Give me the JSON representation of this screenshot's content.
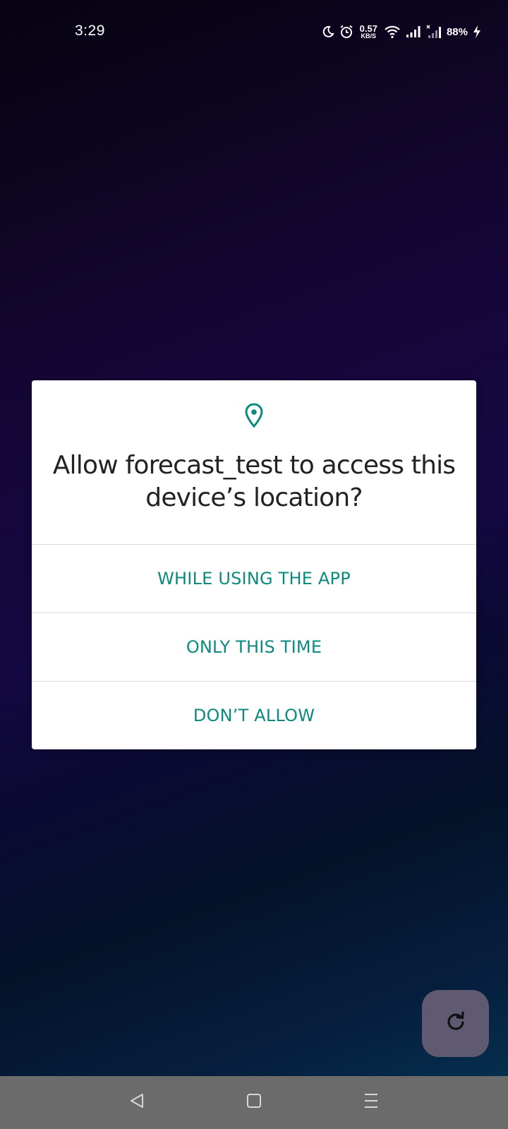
{
  "status_bar": {
    "time": "3:29",
    "net_speed_value": "0.57",
    "net_speed_unit": "KB/S",
    "battery": "88%",
    "icons": [
      "moon-icon",
      "alarm-icon",
      "wifi-icon",
      "signal-icon",
      "signal-no-service-icon",
      "charging-icon"
    ]
  },
  "dialog": {
    "icon": "location-pin-icon",
    "title": "Allow forecast_test to access this device’s location?",
    "buttons": {
      "while_using": "WHILE USING THE APP",
      "only_this_time": "ONLY THIS TIME",
      "dont_allow": "DON’T ALLOW"
    }
  },
  "fab": {
    "icon": "refresh-icon"
  },
  "nav_bar": {
    "icons": [
      "back-icon",
      "home-icon",
      "recents-icon"
    ]
  },
  "colors": {
    "accent": "#0c8a7d",
    "title_text": "#222222",
    "nav_bar": "#6b6b6b",
    "fab": "#5f5a72"
  }
}
